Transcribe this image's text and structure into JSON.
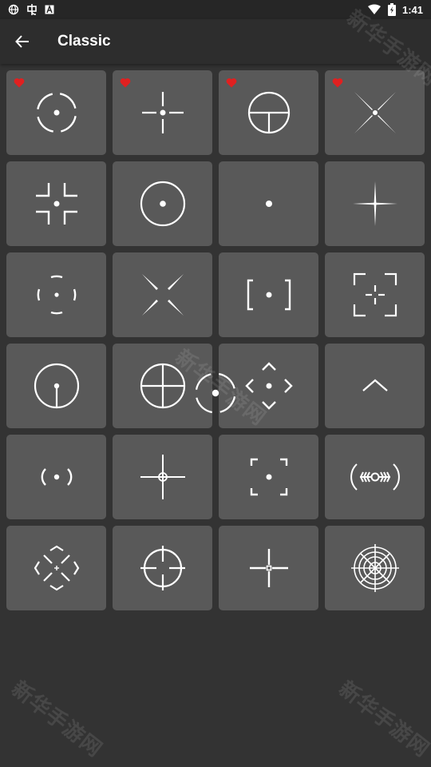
{
  "status_bar": {
    "time": "1:41",
    "left_icons": [
      "globe-icon",
      "bug-icon",
      "a-icon"
    ],
    "right_icons": [
      "wifi-icon",
      "battery-icon"
    ]
  },
  "app_bar": {
    "title": "Classic",
    "back_icon": "arrow-back-icon"
  },
  "colors": {
    "background": "#333333",
    "app_bar": "#2d2d2d",
    "status_bar": "#262626",
    "tile": "#595959",
    "favorite": "#e02020",
    "icon": "#ffffff"
  },
  "crosshairs": [
    {
      "id": 1,
      "favorite": true
    },
    {
      "id": 2,
      "favorite": true
    },
    {
      "id": 3,
      "favorite": true
    },
    {
      "id": 4,
      "favorite": true
    },
    {
      "id": 5,
      "favorite": false
    },
    {
      "id": 6,
      "favorite": false
    },
    {
      "id": 7,
      "favorite": false
    },
    {
      "id": 8,
      "favorite": false
    },
    {
      "id": 9,
      "favorite": false
    },
    {
      "id": 10,
      "favorite": false
    },
    {
      "id": 11,
      "favorite": false
    },
    {
      "id": 12,
      "favorite": false
    },
    {
      "id": 13,
      "favorite": false
    },
    {
      "id": 14,
      "favorite": false
    },
    {
      "id": 15,
      "favorite": false
    },
    {
      "id": 16,
      "favorite": false
    },
    {
      "id": 17,
      "favorite": false
    },
    {
      "id": 18,
      "favorite": false
    },
    {
      "id": 19,
      "favorite": false
    },
    {
      "id": 20,
      "favorite": false
    },
    {
      "id": 21,
      "favorite": false
    },
    {
      "id": 22,
      "favorite": false
    },
    {
      "id": 23,
      "favorite": false
    },
    {
      "id": 24,
      "favorite": false
    }
  ],
  "watermark": "新华手游网"
}
